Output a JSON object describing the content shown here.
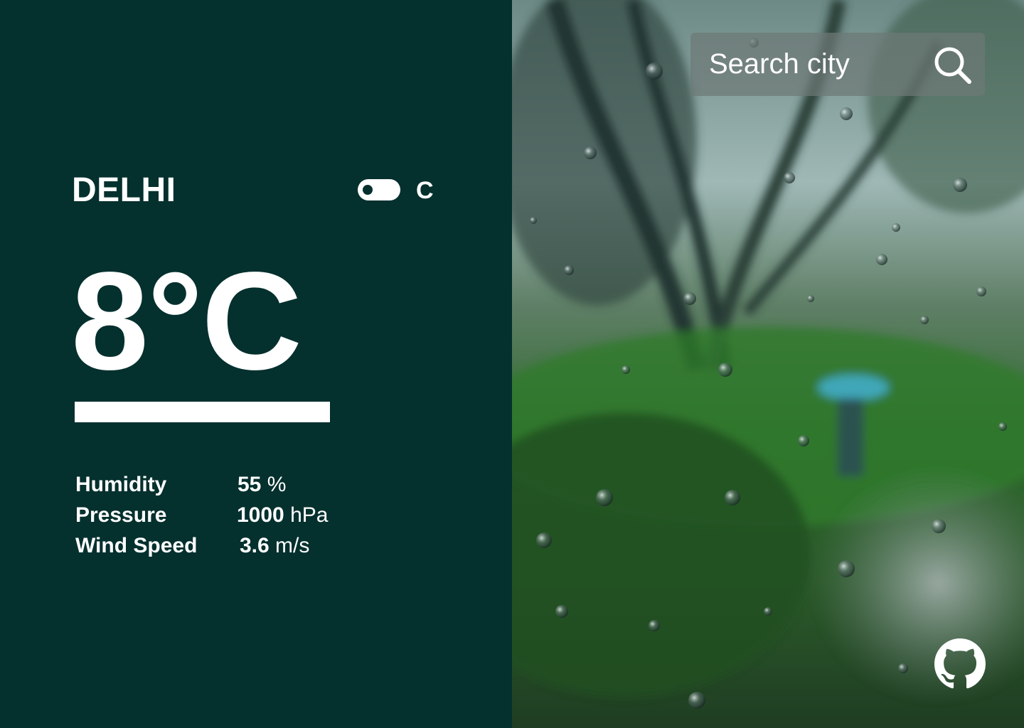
{
  "weather": {
    "city": "DELHI",
    "unit_label": "C",
    "temperature": "8°C",
    "stats": [
      {
        "label": "Humidity",
        "value": "55",
        "unit": " %"
      },
      {
        "label": "Pressure",
        "value": "1000",
        "unit": " hPa"
      },
      {
        "label": "Wind Speed",
        "value": "3.6",
        "unit": " m/s"
      }
    ]
  },
  "search": {
    "placeholder": "Search city"
  },
  "icons": {
    "search": "search-icon",
    "github": "github-icon",
    "toggle": "toggle-switch"
  },
  "colors": {
    "panel_background": "#04302e",
    "text": "#ffffff"
  }
}
